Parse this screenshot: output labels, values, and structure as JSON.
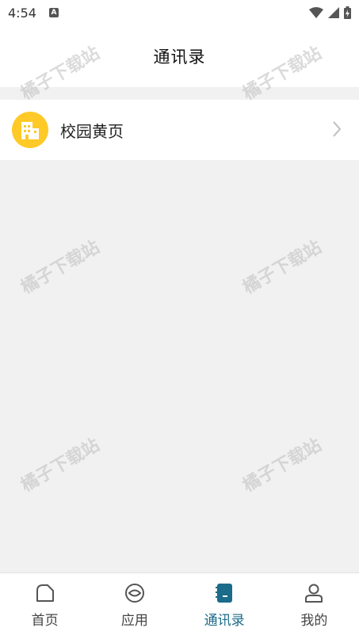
{
  "status_bar": {
    "time": "4:54"
  },
  "header": {
    "title": "通讯录"
  },
  "list": {
    "items": [
      {
        "label": "校园黄页",
        "icon": "building-icon"
      }
    ]
  },
  "tabs": [
    {
      "label": "首页",
      "icon": "home-icon",
      "active": false
    },
    {
      "label": "应用",
      "icon": "apps-icon",
      "active": false
    },
    {
      "label": "通讯录",
      "icon": "contacts-book-icon",
      "active": true
    },
    {
      "label": "我的",
      "icon": "user-icon",
      "active": false
    }
  ],
  "watermark": {
    "text": "橘子下载站"
  },
  "colors": {
    "accent": "#1b6b8a",
    "yellow": "#ffc927",
    "background": "#f1f1f1"
  }
}
